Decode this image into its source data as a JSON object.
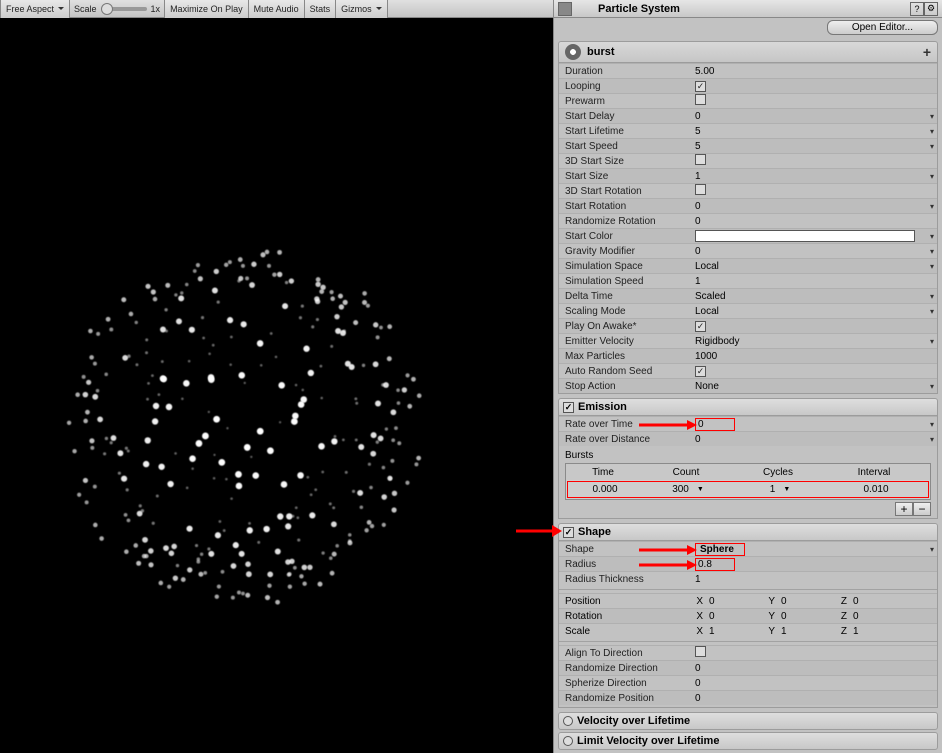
{
  "toolbar": {
    "aspect": "Free Aspect",
    "scale_label": "Scale",
    "scale_value": "1x",
    "maximize": "Maximize On Play",
    "mute": "Mute Audio",
    "stats": "Stats",
    "gizmos": "Gizmos"
  },
  "inspector": {
    "title": "Particle System",
    "open_editor": "Open Editor..."
  },
  "burst_name": "burst",
  "main": {
    "duration_l": "Duration",
    "duration_v": "5.00",
    "looping_l": "Looping",
    "prewarm_l": "Prewarm",
    "start_delay_l": "Start Delay",
    "start_delay_v": "0",
    "start_life_l": "Start Lifetime",
    "start_life_v": "5",
    "start_speed_l": "Start Speed",
    "start_speed_v": "5",
    "sd3_l": "3D Start Size",
    "start_size_l": "Start Size",
    "start_size_v": "1",
    "rot3_l": "3D Start Rotation",
    "start_rot_l": "Start Rotation",
    "start_rot_v": "0",
    "rand_rot_l": "Randomize Rotation",
    "rand_rot_v": "0",
    "start_col_l": "Start Color",
    "grav_l": "Gravity Modifier",
    "grav_v": "0",
    "sim_sp_l": "Simulation Space",
    "sim_sp_v": "Local",
    "sim_spd_l": "Simulation Speed",
    "sim_spd_v": "1",
    "delta_l": "Delta Time",
    "delta_v": "Scaled",
    "scale_mode_l": "Scaling Mode",
    "scale_mode_v": "Local",
    "play_awake_l": "Play On Awake*",
    "emit_vel_l": "Emitter Velocity",
    "emit_vel_v": "Rigidbody",
    "max_p_l": "Max Particles",
    "max_p_v": "1000",
    "auto_seed_l": "Auto Random Seed",
    "stop_act_l": "Stop Action",
    "stop_act_v": "None"
  },
  "emission": {
    "title": "Emission",
    "rot_l": "Rate over Time",
    "rot_v": "0",
    "rod_l": "Rate over Distance",
    "rod_v": "0",
    "bursts_l": "Bursts",
    "cols": {
      "time": "Time",
      "count": "Count",
      "cycles": "Cycles",
      "interval": "Interval"
    },
    "row": {
      "time": "0.000",
      "count": "300",
      "cycles": "1",
      "interval": "0.010"
    }
  },
  "shape": {
    "title": "Shape",
    "shape_l": "Shape",
    "shape_v": "Sphere",
    "radius_l": "Radius",
    "radius_v": "0.8",
    "rthick_l": "Radius Thickness",
    "rthick_v": "1",
    "pos_l": "Position",
    "pos": {
      "x": "0",
      "y": "0",
      "z": "0"
    },
    "rot_l": "Rotation",
    "rot": {
      "x": "0",
      "y": "0",
      "z": "0"
    },
    "scl_l": "Scale",
    "scl": {
      "x": "1",
      "y": "1",
      "z": "1"
    },
    "align_l": "Align To Direction",
    "rand_dir_l": "Randomize Direction",
    "rand_dir_v": "0",
    "sph_dir_l": "Spherize Direction",
    "sph_dir_v": "0",
    "rand_pos_l": "Randomize Position",
    "rand_pos_v": "0"
  },
  "collapsed": {
    "vel": "Velocity over Lifetime",
    "limvel": "Limit Velocity over Lifetime"
  },
  "axis": {
    "x": "X",
    "y": "Y",
    "z": "Z"
  }
}
